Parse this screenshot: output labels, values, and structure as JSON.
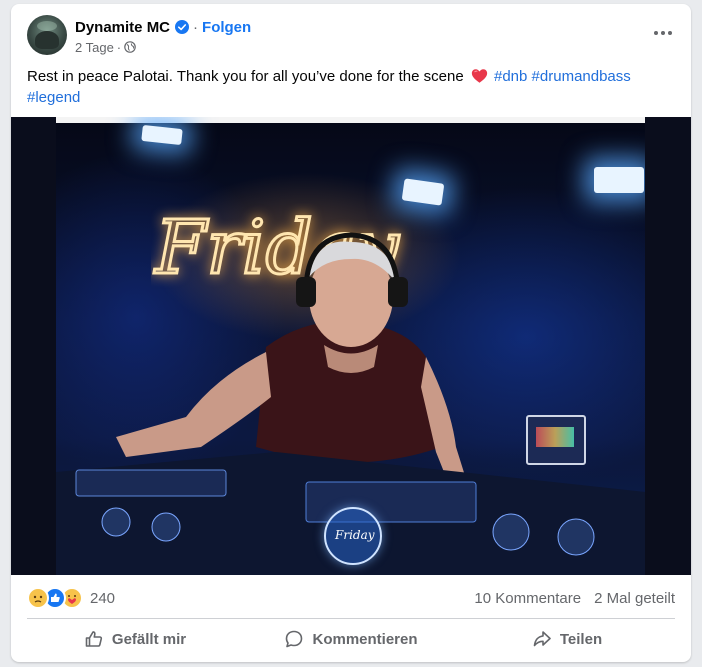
{
  "post": {
    "author": "Dynamite MC",
    "separator": "·",
    "follow_label": "Folgen",
    "time": "2 Tage",
    "meta_dot": "·",
    "text_before": "Rest in peace Palotai. Thank you for all you’ve done for the scene",
    "hashtags": [
      "#dnb",
      "#drumandbass",
      "#legend"
    ],
    "image": {
      "neon_sign_text": "Friday",
      "badge_text": "Friday"
    }
  },
  "engagement": {
    "reaction_icons": [
      "sad-reaction",
      "like-reaction",
      "care-reaction"
    ],
    "reaction_count": "240",
    "comments": "10 Kommentare",
    "shares": "2 Mal geteilt"
  },
  "actions": {
    "like": "Gefällt mir",
    "comment": "Kommentieren",
    "share": "Teilen"
  },
  "colors": {
    "brand_blue": "#1877f2",
    "hashtag": "#216fdb",
    "muted": "#65676b",
    "divider": "#ced0d4",
    "heart": "#e8374a"
  }
}
